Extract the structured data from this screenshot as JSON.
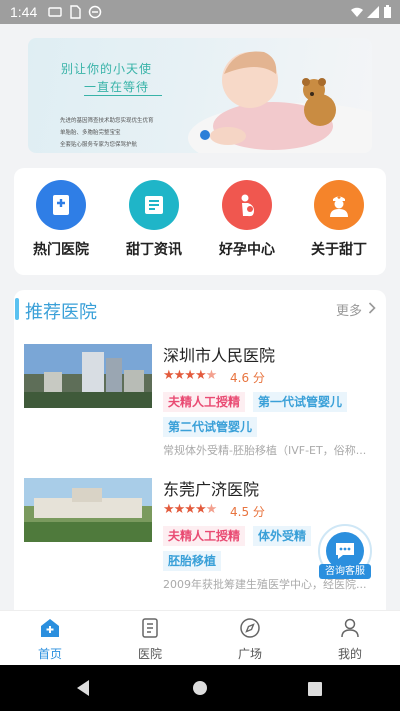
{
  "status_bar": {
    "time": "1:44"
  },
  "banner": {
    "slogan_line1": "别让你的小天使",
    "slogan_line2": "一直在等待",
    "bullets": [
      "先进的基因筛查技术助您实现优生优育",
      "单胎胎、多胞胎完整宝宝",
      "全套贴心服务专家为您保驾护航"
    ]
  },
  "quick_menu": [
    {
      "label": "热门医院",
      "icon": "hospital-icon",
      "color": "#2f7ee6"
    },
    {
      "label": "甜丁资讯",
      "icon": "news-icon",
      "color": "#1fb5c8"
    },
    {
      "label": "好孕中心",
      "icon": "pregnancy-icon",
      "color": "#f0574f"
    },
    {
      "label": "关于甜丁",
      "icon": "nurse-icon",
      "color": "#f5842a"
    }
  ],
  "recommend": {
    "title": "推荐医院",
    "more_label": "更多",
    "hospitals": [
      {
        "name": "深圳市人民医院",
        "rating": 4.6,
        "score_text": "4.6 分",
        "tags": [
          "夫精人工授精",
          "第一代试管婴儿",
          "第二代试管婴儿"
        ],
        "description": "常规体外受精-胚胎移植（IVF-ET，俗称..."
      },
      {
        "name": "东莞广济医院",
        "rating": 4.5,
        "score_text": "4.5 分",
        "tags": [
          "夫精人工授精",
          "体外受精",
          "胚胎移植"
        ],
        "description": "2009年获批筹建生殖医学中心，经医院..."
      }
    ]
  },
  "floating_button": {
    "label": "咨询客服"
  },
  "tab_bar": [
    {
      "label": "首页",
      "icon": "home-icon",
      "active": true
    },
    {
      "label": "医院",
      "icon": "hospital-list-icon",
      "active": false
    },
    {
      "label": "广场",
      "icon": "compass-icon",
      "active": false
    },
    {
      "label": "我的",
      "icon": "user-icon",
      "active": false
    }
  ],
  "colors": {
    "primary": "#2b8fde",
    "star": "#e35b3d",
    "tag_pink": "#e94b73",
    "tag_blue": "#3aa0d8"
  }
}
